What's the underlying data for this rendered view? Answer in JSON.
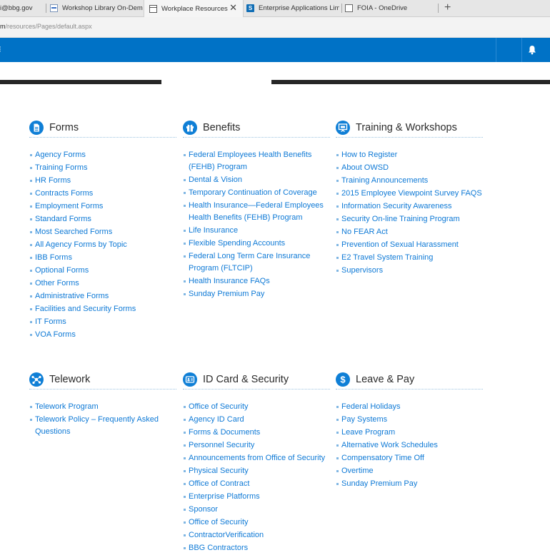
{
  "browser": {
    "tabs": [
      {
        "label": "i@bbg.gov",
        "icon": "mail-icon"
      },
      {
        "label": "Workshop Library On-Dema",
        "icon": "email-favicon-icon"
      },
      {
        "label": "Workplace Resources",
        "icon": "page-icon",
        "active": true
      },
      {
        "label": "Enterprise Applications Limi",
        "icon": "sharepoint-icon"
      },
      {
        "label": "FOIA - OneDrive",
        "icon": "onedrive-icon"
      }
    ],
    "close_symbol": "✕",
    "new_tab_symbol": "+",
    "url_host": "m",
    "url_path": "/resources/Pages/default.aspx"
  },
  "suite_bar": {
    "color": "#0072c6",
    "left_glyph": "⁝",
    "bell_icon": "bell-icon"
  },
  "colors": {
    "link": "#0f7ad6",
    "icon_circle": "#0f7fd6",
    "band": "#262626"
  },
  "sections": [
    {
      "id": "forms",
      "title": "Forms",
      "icon": "document-icon",
      "links": [
        "Agency Forms",
        "Training Forms",
        "HR Forms",
        "Contracts Forms",
        "Employment Forms",
        "Standard Forms",
        "Most Searched Forms",
        "All Agency Forms by Topic",
        "IBB Forms",
        "Optional Forms",
        "Other Forms",
        "Administrative Forms",
        "Facilities and Security Forms",
        "IT Forms",
        "VOA Forms"
      ]
    },
    {
      "id": "benefits",
      "title": "Benefits",
      "icon": "gift-icon",
      "links": [
        "Federal Employees Health Benefits (FEHB) Program",
        "Dental & Vision",
        "Temporary Continuation of Coverage",
        "Health Insurance—Federal Employees Health Benefits (FEHB) Program",
        "Life Insurance",
        "Flexible Spending Accounts",
        "Federal Long Term Care Insurance Program (FLTCIP)",
        "Health Insurance FAQs",
        "Sunday Premium Pay"
      ]
    },
    {
      "id": "training",
      "title": "Training & Workshops",
      "icon": "presentation-icon",
      "links": [
        "How to Register",
        "About OWSD",
        "Training Announcements",
        "2015 Employee Viewpoint Survey FAQS",
        "Information Security Awareness",
        "Security On-line Training Program",
        "No FEAR Act",
        "Prevention of Sexual Harassment",
        "E2 Travel System Training",
        "Supervisors"
      ]
    },
    {
      "id": "telework",
      "title": "Telework",
      "icon": "network-icon",
      "links": [
        "Telework Program",
        "Telework Policy – Frequently Asked Questions"
      ]
    },
    {
      "id": "idcard",
      "title": "ID Card & Security",
      "icon": "id-card-icon",
      "links": [
        "Office of Security",
        "Agency ID Card",
        "Forms & Documents",
        "Personnel Security",
        "Announcements from Office of Security",
        "Physical Security",
        "Office of Contract",
        "Enterprise Platforms",
        "Sponsor",
        "Office of Security",
        "ContractorVerification",
        "BBG Contractors"
      ]
    },
    {
      "id": "leave",
      "title": "Leave & Pay",
      "icon": "dollar-icon",
      "links": [
        "Federal Holidays",
        "Pay Systems",
        "Leave Program",
        "Alternative Work Schedules",
        "Compensatory Time Off",
        "Overtime",
        "Sunday Premium Pay"
      ]
    }
  ]
}
